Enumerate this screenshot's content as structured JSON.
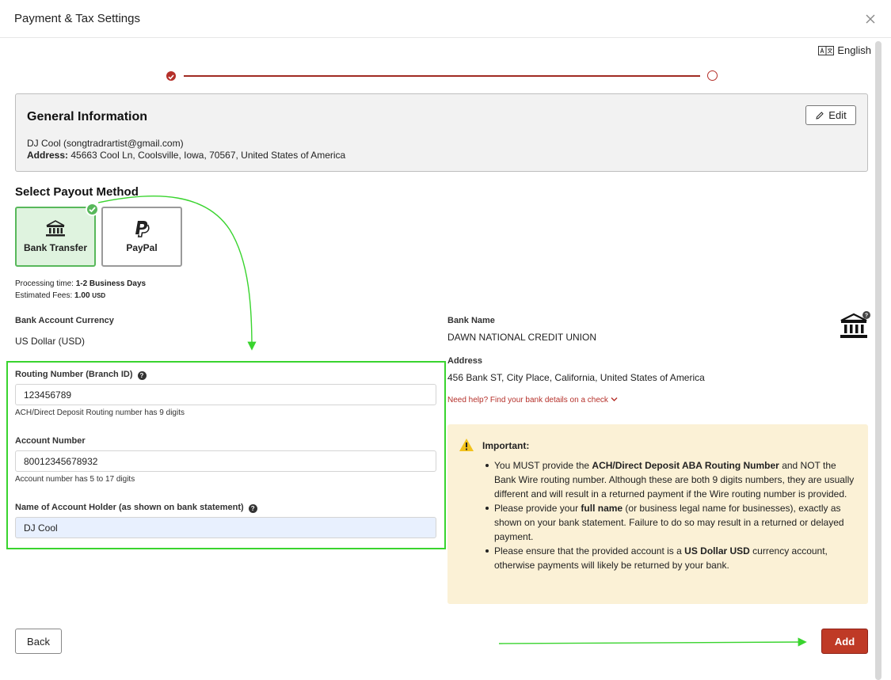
{
  "header": {
    "title": "Payment & Tax Settings"
  },
  "language": {
    "label": "English"
  },
  "general": {
    "title": "General Information",
    "name_line": "DJ Cool (songtradrartist@gmail.com)",
    "address_label": "Address:",
    "address_value": "45663 Cool Ln, Coolsville, Iowa, 70567, United States of America",
    "edit_label": "Edit"
  },
  "payout": {
    "title": "Select Payout Method",
    "methods": [
      {
        "label": "Bank Transfer",
        "selected": true
      },
      {
        "label": "PayPal",
        "selected": false
      }
    ],
    "processing_label": "Processing time:",
    "processing_value": "1-2 Business Days",
    "fees_label": "Estimated Fees:",
    "fees_value": "1.00",
    "fees_currency": "USD"
  },
  "currency": {
    "label": "Bank Account Currency",
    "value": "US Dollar (USD)"
  },
  "bank": {
    "name_label": "Bank Name",
    "name_value": "DAWN NATIONAL CREDIT UNION",
    "address_label": "Address",
    "address_value": "456 Bank ST, City Place, California, United States of America",
    "help_link": "Need help? Find your bank details on a check"
  },
  "form": {
    "routing_label": "Routing Number (Branch ID)",
    "routing_value": "123456789",
    "routing_hint": "ACH/Direct Deposit Routing number has 9 digits",
    "account_label": "Account Number",
    "account_value": "80012345678932",
    "account_hint": "Account number has 5 to 17 digits",
    "holder_label": "Name of Account Holder (as shown on bank statement)",
    "holder_value": "DJ Cool"
  },
  "important": {
    "title": "Important:",
    "b1_pre": "You MUST provide the ",
    "b1_bold": "ACH/Direct Deposit ABA Routing Number",
    "b1_post": " and NOT the Bank Wire routing number. Although these are both 9 digits numbers, they are usually different and will result in a returned payment if the Wire routing number is provided.",
    "b2_pre": "Please provide your ",
    "b2_bold": "full name",
    "b2_post": " (or business legal name for businesses), exactly as shown on your bank statement. Failure to do so may result in a returned or delayed payment.",
    "b3_pre": "Please ensure that the provided account is a ",
    "b3_bold": "US Dollar USD",
    "b3_post": " currency account, otherwise payments will likely be returned by your bank."
  },
  "footer": {
    "back_label": "Back",
    "add_label": "Add"
  },
  "colors": {
    "brand": "#bf3a26",
    "success": "#58b85b",
    "annotation": "#39d42e",
    "warning_bg": "#fbf1d6"
  }
}
